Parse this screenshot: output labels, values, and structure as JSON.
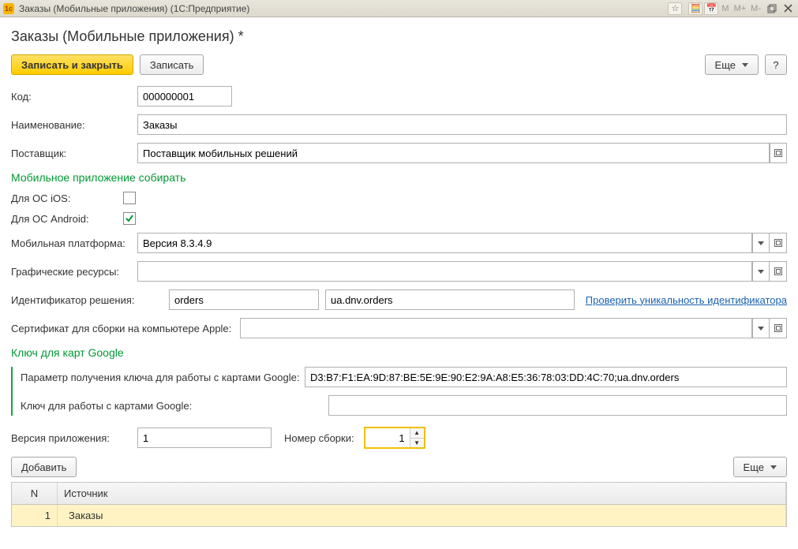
{
  "window": {
    "title": "Заказы (Мобильные приложения)  (1С:Предприятие)",
    "mem": {
      "m": "M",
      "mplus": "M+",
      "mminus": "M-"
    }
  },
  "page": {
    "title": "Заказы (Мобильные приложения) *"
  },
  "toolbar": {
    "write_close": "Записать и закрыть",
    "write": "Записать",
    "more": "Еще",
    "help": "?"
  },
  "fields": {
    "code_label": "Код:",
    "code_value": "000000001",
    "name_label": "Наименование:",
    "name_value": "Заказы",
    "vendor_label": "Поставщик:",
    "vendor_value": "Поставщик мобильных решений"
  },
  "build": {
    "section_title": "Мобильное приложение собирать",
    "ios_label": "Для ОС iOS:",
    "ios_checked": false,
    "android_label": "Для ОС Android:",
    "android_checked": true,
    "platform_label": "Мобильная платформа:",
    "platform_value": "Версия 8.3.4.9",
    "graphics_label": "Графические ресурсы:",
    "graphics_value": "",
    "solution_id_label": "Идентификатор решения:",
    "solution_id_short": "orders",
    "solution_id_full": "ua.dnv.orders",
    "check_uniqueness_link": "Проверить уникальность идентификатора",
    "apple_cert_label": "Сертификат для сборки на компьютере Apple:",
    "apple_cert_value": ""
  },
  "google": {
    "section_title": "Ключ для карт Google",
    "param_label": "Параметр получения ключа для работы с картами Google:",
    "param_value": "D3:B7:F1:EA:9D:87:BE:5E:9E:90:E2:9A:A8:E5:36:78:03:DD:4C:70;ua.dnv.orders",
    "key_label": "Ключ для работы с картами Google:",
    "key_value": ""
  },
  "version": {
    "app_label": "Версия приложения:",
    "app_value": "1",
    "build_label": "Номер сборки:",
    "build_value": "1"
  },
  "sources": {
    "add_button": "Добавить",
    "more": "Еще",
    "col_n": "N",
    "col_source": "Источник",
    "rows": [
      {
        "n": "1",
        "source": "Заказы"
      }
    ]
  }
}
